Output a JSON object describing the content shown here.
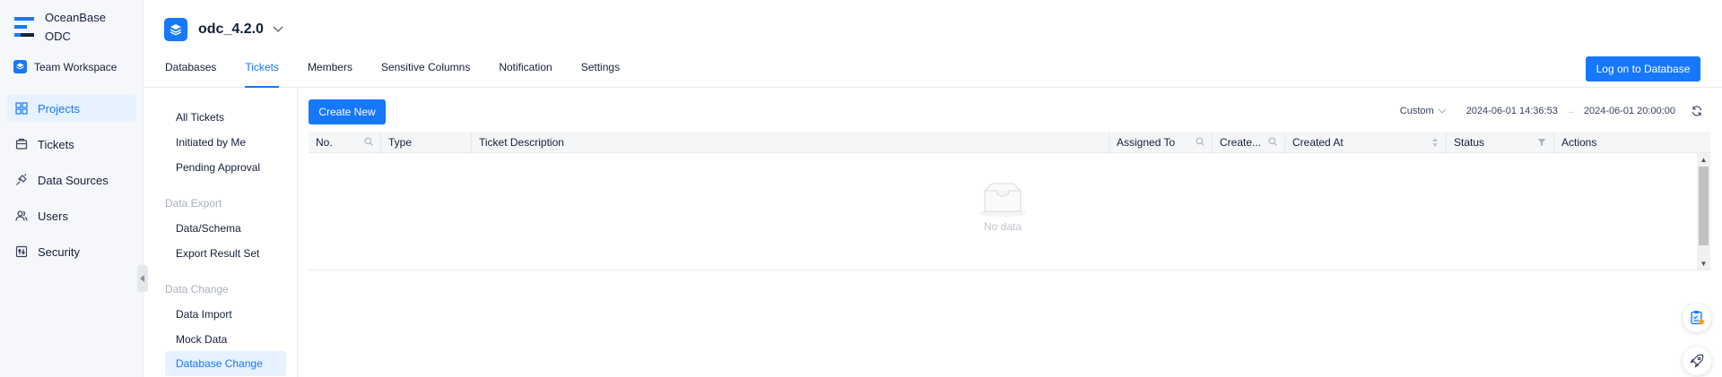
{
  "brand": {
    "line1": "OceanBase",
    "line2": "ODC"
  },
  "workspace": {
    "label": "Team Workspace"
  },
  "nav": {
    "items": [
      {
        "label": "Projects"
      },
      {
        "label": "Tickets"
      },
      {
        "label": "Data Sources"
      },
      {
        "label": "Users"
      },
      {
        "label": "Security"
      }
    ]
  },
  "project": {
    "name": "odc_4.2.0"
  },
  "tabs": [
    {
      "label": "Databases"
    },
    {
      "label": "Tickets"
    },
    {
      "label": "Members"
    },
    {
      "label": "Sensitive Columns"
    },
    {
      "label": "Notification"
    },
    {
      "label": "Settings"
    }
  ],
  "header": {
    "logon_label": "Log on to Database"
  },
  "subnav": {
    "all": "All Tickets",
    "initiated": "Initiated by Me",
    "pending": "Pending Approval",
    "group_export": "Data Export",
    "data_schema": "Data/Schema",
    "export_result": "Export Result Set",
    "group_change": "Data Change",
    "data_import": "Data Import",
    "mock_data": "Mock Data",
    "db_change": "Database Change"
  },
  "toolbar": {
    "create_label": "Create New",
    "range_label": "Custom",
    "start": "2024-06-01 14:36:53",
    "end": "2024-06-01 20:00:00"
  },
  "table": {
    "columns": [
      {
        "label": "No."
      },
      {
        "label": "Type"
      },
      {
        "label": "Ticket Description"
      },
      {
        "label": "Assigned To"
      },
      {
        "label": "Create..."
      },
      {
        "label": "Created At"
      },
      {
        "label": "Status"
      },
      {
        "label": "Actions"
      }
    ],
    "empty_text": "No data"
  },
  "colors": {
    "accent": "#1677ff",
    "sidebar_bg": "#f6f7fa",
    "header_bg": "#f5f6f8"
  }
}
